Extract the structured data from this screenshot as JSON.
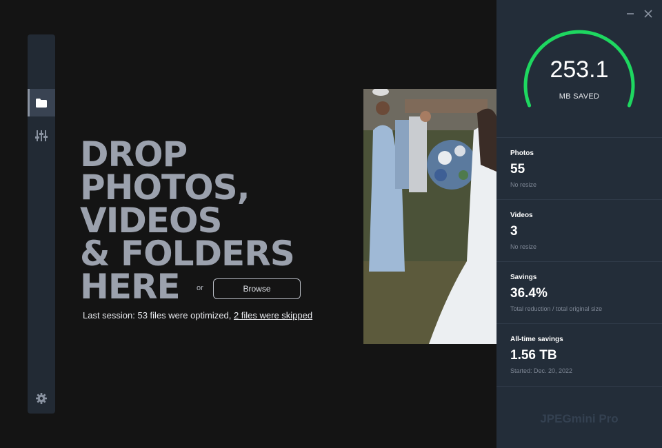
{
  "sidebar": {
    "items": [
      {
        "id": "folder",
        "icon": "folder-icon",
        "active": true
      },
      {
        "id": "settings-sliders",
        "icon": "sliders-icon",
        "active": false
      }
    ],
    "footer_icon": "gear-icon"
  },
  "dropzone": {
    "lines": [
      "DROP",
      "PHOTOS,",
      "VIDEOS",
      "& FOLDERS",
      "HERE"
    ],
    "or_label": "or",
    "browse_label": "Browse"
  },
  "last_session": {
    "prefix": "Last session: 53 files were optimized, ",
    "skipped_link": "2 files were skipped"
  },
  "gauge": {
    "value": "253.1",
    "unit": "MB SAVED",
    "fill_fraction": 1.0,
    "color": "#1ed760"
  },
  "stats": [
    {
      "title": "Photos",
      "value": "55",
      "sub": "No resize"
    },
    {
      "title": "Videos",
      "value": "3",
      "sub": "No resize"
    },
    {
      "title": "Savings",
      "value": "36.4%",
      "sub": "Total reduction / total original size"
    },
    {
      "title": "All-time savings",
      "value": "1.56 TB",
      "sub": "Started: Dec. 20, 2022"
    }
  ],
  "window": {
    "minimize_icon": "minimize-icon",
    "close_icon": "close-icon"
  },
  "brand": {
    "name": "JPEGmini Pro"
  },
  "colors": {
    "accent": "#1ed760",
    "panel": "#232d39",
    "background": "#141414"
  }
}
